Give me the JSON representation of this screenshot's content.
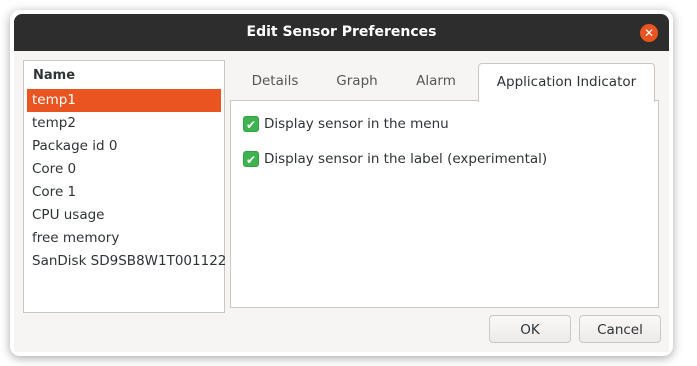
{
  "window": {
    "title": "Edit Sensor Preferences",
    "close_icon": "close-icon",
    "accent_color": "#e95420",
    "titlebar_color": "#2d2d2d"
  },
  "sensor_list": {
    "header": "Name",
    "items": [
      {
        "label": "temp1",
        "selected": true
      },
      {
        "label": "temp2",
        "selected": false
      },
      {
        "label": "Package id 0",
        "selected": false
      },
      {
        "label": "Core 0",
        "selected": false
      },
      {
        "label": "Core 1",
        "selected": false
      },
      {
        "label": "CPU usage",
        "selected": false
      },
      {
        "label": "free memory",
        "selected": false
      },
      {
        "label": "SanDisk SD9SB8W1T001122",
        "selected": false
      }
    ]
  },
  "tabs": {
    "items": [
      {
        "label": "Details",
        "active": false
      },
      {
        "label": "Graph",
        "active": false
      },
      {
        "label": "Alarm",
        "active": false
      },
      {
        "label": "Application Indicator",
        "active": true
      }
    ]
  },
  "indicator": {
    "options": [
      {
        "label": "Display sensor in the menu",
        "checked": true
      },
      {
        "label": "Display sensor in the label (experimental)",
        "checked": true
      }
    ],
    "check_color": "#3eb34f"
  },
  "buttons": {
    "ok": "OK",
    "cancel": "Cancel"
  }
}
